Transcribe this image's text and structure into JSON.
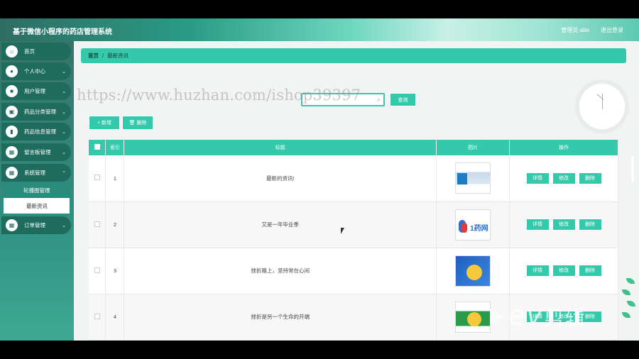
{
  "header": {
    "title": "基于微信小程序的药店管理系统",
    "user": "管理员 abo",
    "logout": "退出登录"
  },
  "sidebar": {
    "items": [
      {
        "label": "首页",
        "icon": "home-icon"
      },
      {
        "label": "个人中心",
        "icon": "user-icon"
      },
      {
        "label": "用户管理",
        "icon": "users-icon"
      },
      {
        "label": "药品分类管理",
        "icon": "category-icon"
      },
      {
        "label": "药品信息管理",
        "icon": "chart-icon"
      },
      {
        "label": "留言板管理",
        "icon": "grid-icon"
      },
      {
        "label": "系统管理",
        "icon": "grid-icon"
      },
      {
        "label": "订单管理",
        "icon": "grid-icon"
      }
    ],
    "sub_items": [
      "轮播图管理",
      "最新资讯"
    ]
  },
  "breadcrumb": {
    "home": "首页",
    "separator": "/",
    "current": "最新资讯"
  },
  "watermark": "https://www.huzhan.com/ishop39397",
  "search": {
    "placeholder": "",
    "button": "查询"
  },
  "toolbar": {
    "add": "+ 新增",
    "delete": "🗑 删除"
  },
  "table": {
    "headers": [
      "",
      "索引",
      "标题",
      "图片",
      "操作"
    ],
    "rows": [
      {
        "index": "1",
        "title": "最新的资讯!"
      },
      {
        "index": "2",
        "title": "又是一年毕业季"
      },
      {
        "index": "3",
        "title": "挫折路上，坚持常在心间"
      },
      {
        "index": "4",
        "title": "挫折是另一个生命的开端"
      }
    ],
    "thumb2_text": "1药网",
    "actions": {
      "detail": "详情",
      "edit": "修改",
      "delete": "删除"
    }
  },
  "overlay_logo": {
    "ev": "ev",
    "cn": "剪辑"
  },
  "colors": {
    "accent": "#34c9ab",
    "sidebar": "#1f6b5e"
  }
}
